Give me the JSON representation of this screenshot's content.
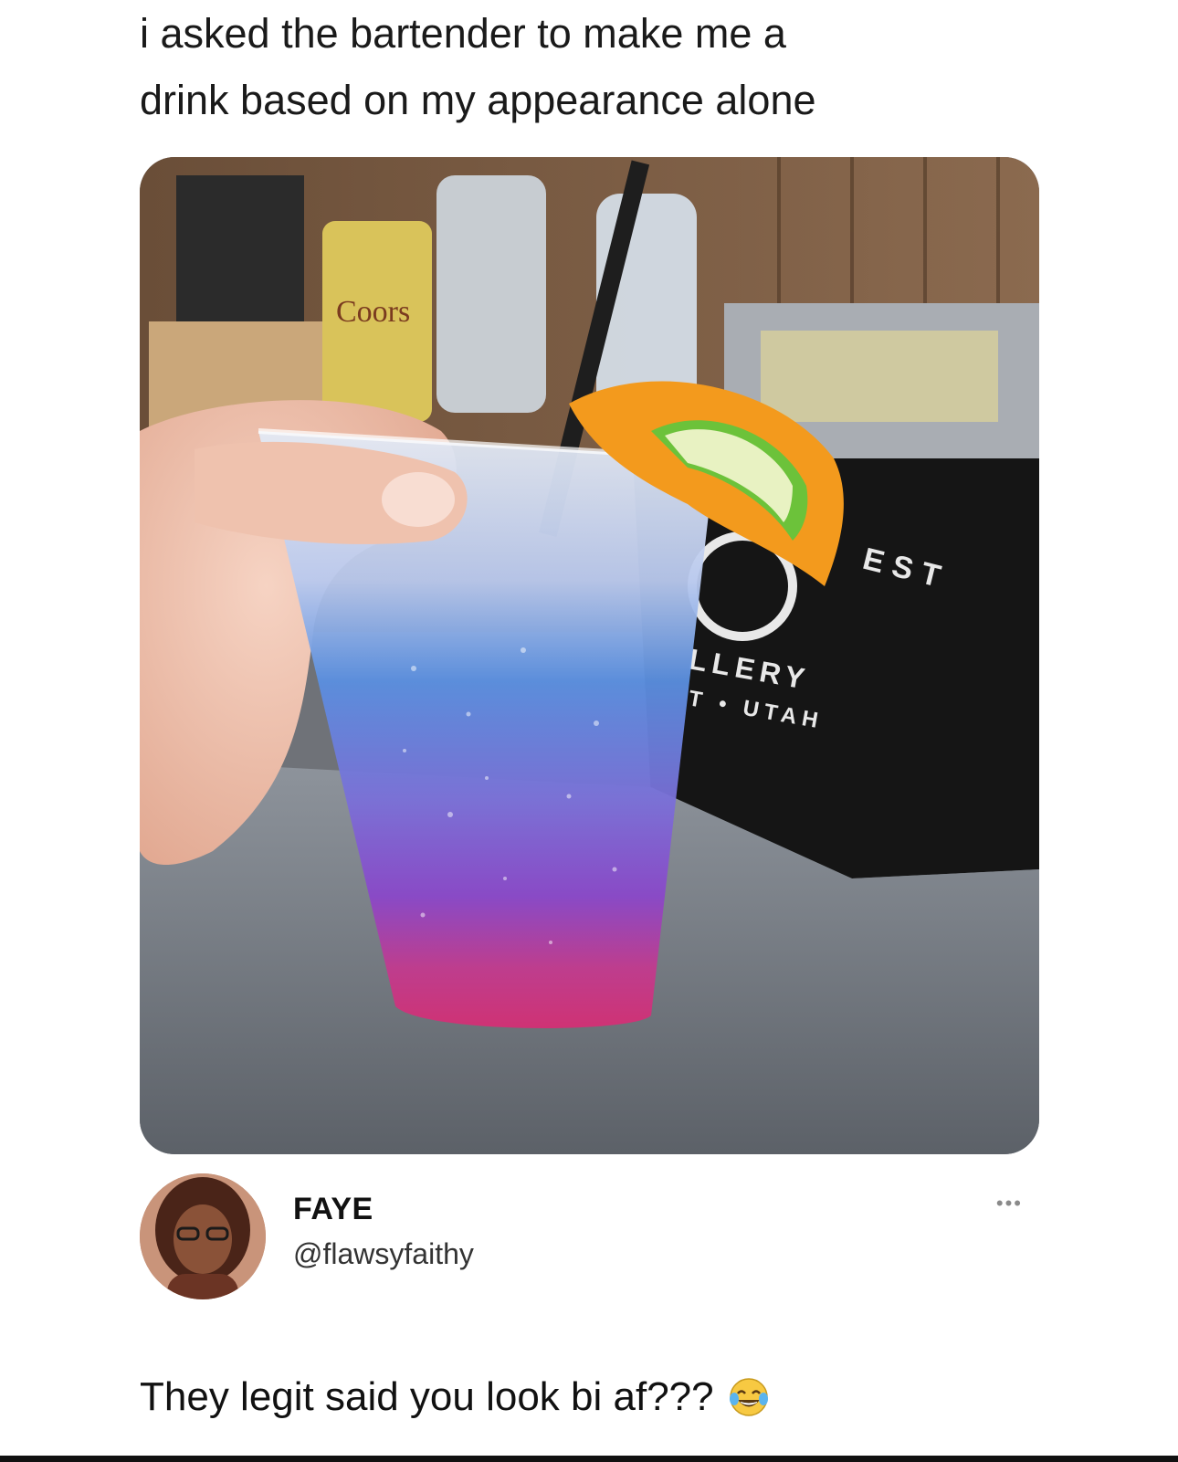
{
  "caption": {
    "line1": "i asked the bartender to make me a",
    "line2": "drink based on my appearance alone"
  },
  "photo": {
    "subject": "layered cocktail in plastic cup",
    "can_label": "Coors",
    "mat_text_1": "EST",
    "mat_text_2": "LLERY",
    "mat_text_3": "T • UTAH"
  },
  "author": {
    "display_name": "FAYE",
    "handle": "@flawsyfaithy",
    "more_label": "•••"
  },
  "tweet": {
    "text": "They legit said you look bi af???",
    "emoji_icon": "face-with-tears-of-joy-icon"
  },
  "colors": {
    "drink_pink": "#d42f74",
    "drink_purple": "#7a4ad6",
    "drink_blue": "#5a8fe0",
    "orange": "#f39a1d",
    "lime": "#6cc23a"
  }
}
